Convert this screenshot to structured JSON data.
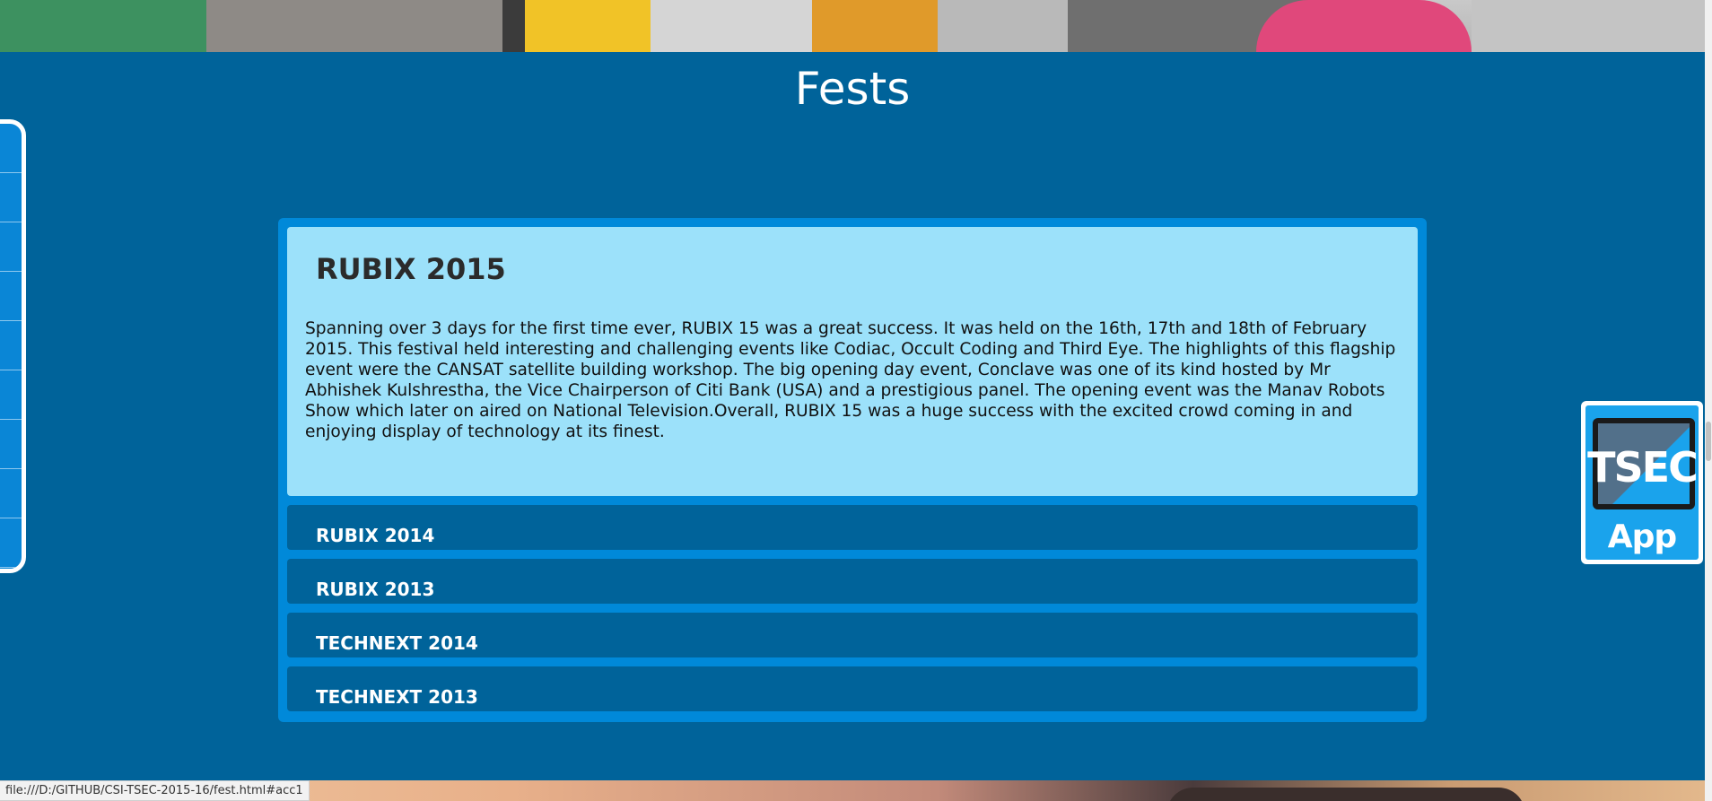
{
  "page": {
    "title": "Fests"
  },
  "accordion": {
    "open_panel": {
      "title": "RUBIX 2015",
      "body": "Spanning over 3 days for the first time ever, RUBIX 15 was a great success. It was held on the 16th, 17th and 18th of February 2015. This festival held interesting and challenging events like Codiac, Occult Coding and Third Eye. The highlights of this flagship event were the CANSAT satellite building workshop. The big opening day event, Conclave was one of its kind hosted by Mr Abhishek Kulshrestha, the Vice Chairperson of Citi Bank (USA) and a prestigious panel. The opening event was the Manav Robots Show which later on aired on National Television.Overall, RUBIX 15 was a huge success with the excited crowd coming in and enjoying display of technology at its finest."
    },
    "closed_panels": [
      {
        "title": "RUBIX 2014"
      },
      {
        "title": "RUBIX 2013"
      },
      {
        "title": "TECHNEXT 2014"
      },
      {
        "title": "TECHNEXT 2013"
      }
    ]
  },
  "app_badge": {
    "line1": "TSEC",
    "line2": "App"
  },
  "status_bar": {
    "url": "file:///D:/GITHUB/CSI-TSEC-2015-16/fest.html#acc1"
  },
  "colors": {
    "page_bg": "#00639a",
    "accordion_frame": "#0089d9",
    "open_panel_bg": "#9ce1fa",
    "closed_panel_bg": "#00639a"
  },
  "icons": [
    "tsec-app-icon"
  ]
}
